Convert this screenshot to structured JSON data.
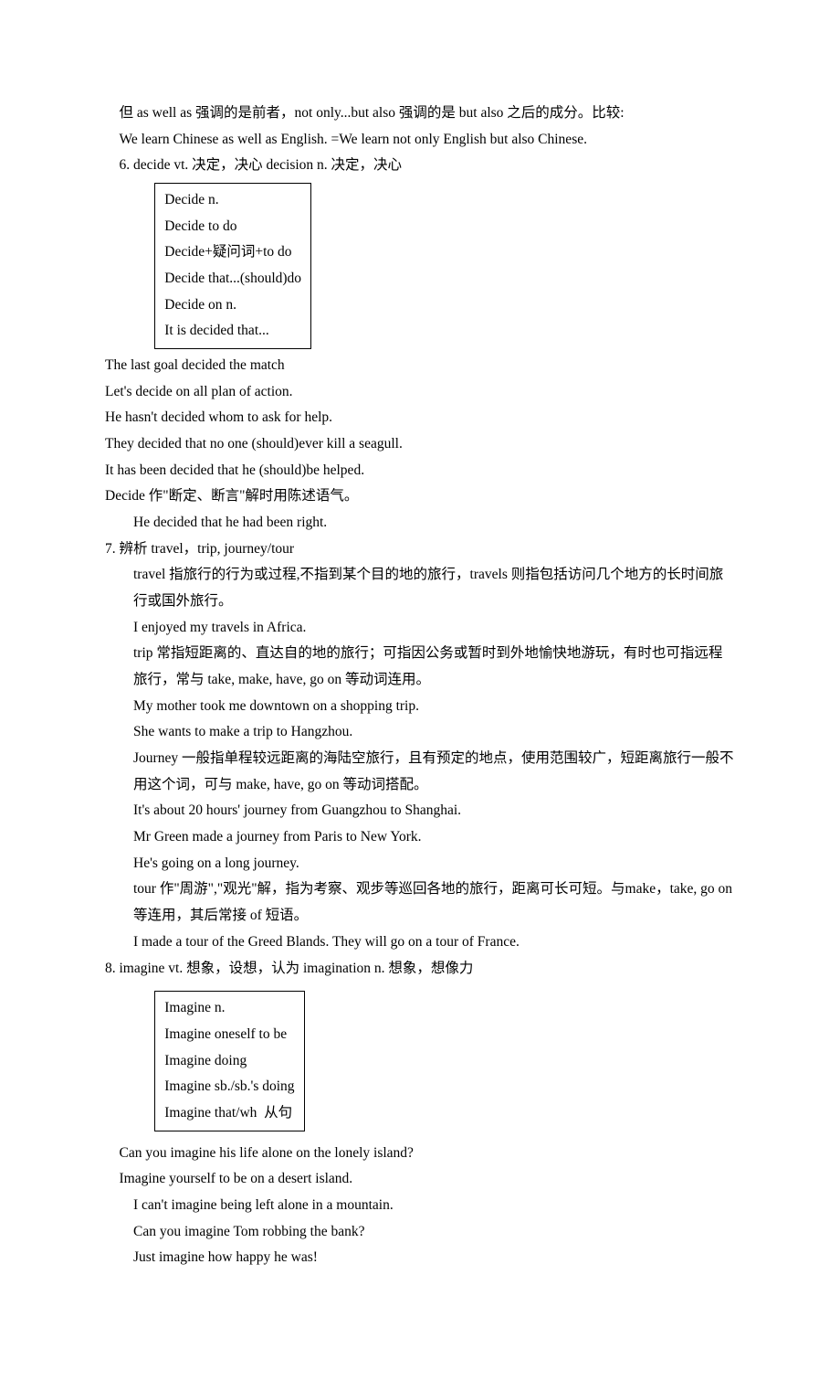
{
  "p1": "但 as well as 强调的是前者，not only...but also 强调的是 but also 之后的成分。比较:",
  "p2": "We learn Chinese as well as English. =We learn not only English but also Chinese.",
  "p3": "6. decide vt. 决定，决心 decision n. 决定，决心",
  "box1": {
    "l1": "Decide n.",
    "l2": "Decide to do",
    "l3": "Decide+疑问词+to do",
    "l4": "Decide that...(should)do",
    "l5": "Decide on n.",
    "l6": "It is decided that..."
  },
  "p4": "The last goal decided the match",
  "p5": "Let's decide on all plan of action.",
  "p6": "He hasn't decided whom to ask for help.",
  "p7": "They decided that no one (should)ever kill a seagull.",
  "p8": "It has been decided that he (should)be helped.",
  "p9": "Decide 作\"断定、断言\"解时用陈述语气。",
  "p10": "He decided that he had been right.",
  "p11": "7. 辨析 travel，trip, journey/tour",
  "p12": "travel 指旅行的行为或过程,不指到某个目的地的旅行，travels 则指包括访问几个地方的长时间旅行或国外旅行。",
  "p13": "I enjoyed my travels in Africa.",
  "p14": "trip 常指短距离的、直达自的地的旅行；可指因公务或暂时到外地愉快地游玩，有时也可指远程旅行，常与 take, make, have, go on 等动词连用。",
  "p15": "My mother took me downtown on a shopping trip.",
  "p16": "She wants to make a trip to Hangzhou.",
  "p17": "Journey 一般指单程较远距离的海陆空旅行，且有预定的地点，使用范围较广，短距离旅行一般不用这个词，可与 make, have, go on 等动词搭配。",
  "p18": "It's about 20 hours' journey from Guangzhou to Shanghai.",
  "p19": "Mr Green made a journey from Paris to New York.",
  "p20": "He's going on a long journey.",
  "p21": "tour 作\"周游\",\"观光\"解，指为考察、观步等巡回各地的旅行，距离可长可短。与make，take, go on 等连用，其后常接 of 短语。",
  "p22": "I made a tour of the Greed Blands. They will go on a tour of France.",
  "p23": "8. imagine vt. 想象，设想，认为 imagination n. 想象，想像力",
  "box2": {
    "l1": "Imagine n.",
    "l2": "Imagine oneself to be",
    "l3": "Imagine doing",
    "l4": "Imagine sb./sb.'s doing",
    "l5": "Imagine that/wh  从句"
  },
  "p24": "Can you imagine his life alone on the lonely island?",
  "p25": "Imagine yourself to be on a desert island.",
  "p26": "I can't imagine being left alone in a mountain.",
  "p27": "Can you imagine Tom robbing the bank?",
  "p28": "Just imagine how happy he was!"
}
